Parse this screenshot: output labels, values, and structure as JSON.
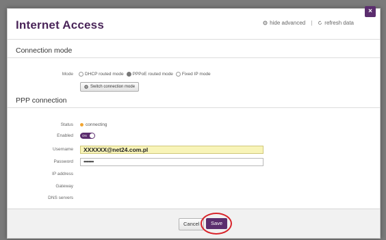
{
  "dialog": {
    "title": "Internet Access",
    "close_label": "×",
    "header_links": {
      "hide_advanced": "hide advanced",
      "separator": "|",
      "refresh_data": "refresh data"
    }
  },
  "connection_mode": {
    "heading": "Connection mode",
    "mode_label": "Mode",
    "options": [
      "DHCP routed mode",
      "PPPoE routed mode",
      "Fixed IP mode"
    ],
    "selected_index": 1,
    "switch_button": "Switch connection mode"
  },
  "ppp_connection": {
    "heading": "PPP connection",
    "status_label": "Status",
    "status_value": "connecting",
    "status_color": "#f2a531",
    "enabled_label": "Enabled",
    "enabled_toggle_text": "ON",
    "username_label": "Username",
    "username_value": "XXXXXX@net24.com.pl",
    "password_label": "Password",
    "password_value": "••••••••",
    "ip_label": "IP address",
    "gateway_label": "Gateway",
    "dns_label": "DNS servers"
  },
  "footer": {
    "cancel_label": "Cancel",
    "save_label": "Save"
  },
  "colors": {
    "accent": "#5b2d6e",
    "highlight": "#d8232a"
  }
}
